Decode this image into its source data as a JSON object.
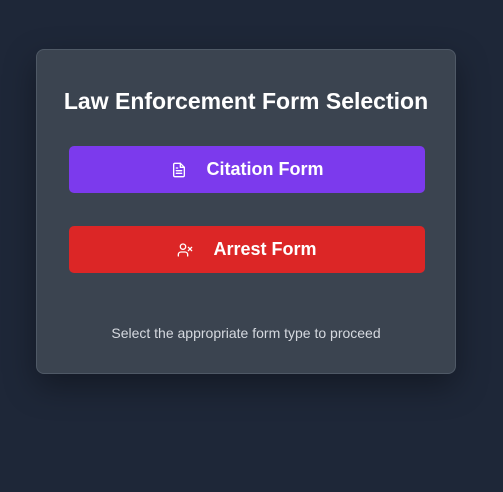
{
  "card": {
    "title": "Law Enforcement Form Selection",
    "footer_text": "Select the appropriate form type to proceed"
  },
  "buttons": {
    "citation": {
      "label": "Citation Form",
      "icon": "document-icon",
      "color": "#7c3aed"
    },
    "arrest": {
      "label": "Arrest Form",
      "icon": "user-x-icon",
      "color": "#dc2626"
    }
  },
  "colors": {
    "background": "#1e2738",
    "card": "#3b4450",
    "text": "#ffffff",
    "muted_text": "#d5d9df"
  }
}
